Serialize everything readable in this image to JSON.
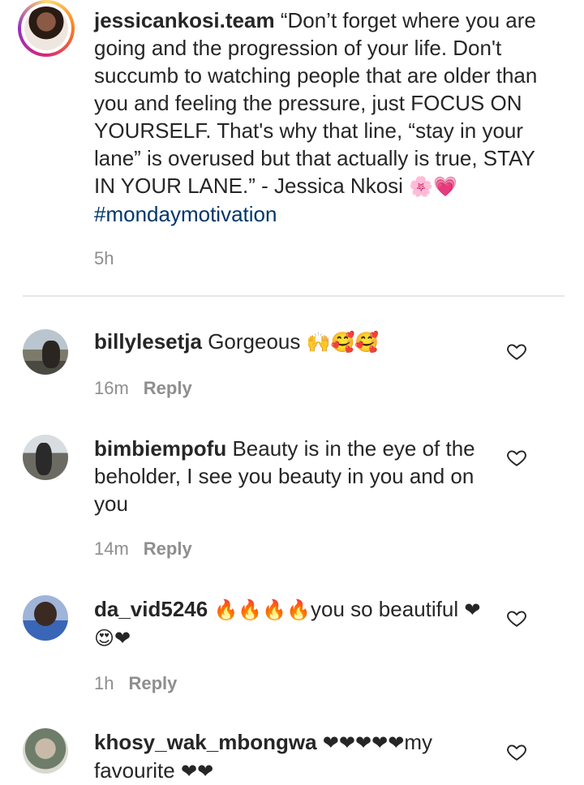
{
  "post": {
    "username": "jessicankosi.team",
    "caption": "“Don’t forget where you are going and the progression of your life. Don't succumb to watching people that are older than you and feeling the pressure, just FOCUS ON YOURSELF. That's why that line, “stay in your lane” is overused but that actually is true, STAY IN YOUR LANE.” - Jessica Nkosi",
    "emojis": "🌸💗",
    "hashtag": "#mondaymotivation",
    "time": "5h"
  },
  "reply_label": "Reply",
  "comments": [
    {
      "username": "billylesetja",
      "text": "Gorgeous",
      "emojis": "🙌🥰🥰",
      "time": "16m"
    },
    {
      "username": "bimbiempofu",
      "text": "Beauty is in the eye of the beholder, I see you beauty in you and on you",
      "emojis": "",
      "time": "14m"
    },
    {
      "username": "da_vid5246",
      "pre_emojis": "🔥🔥🔥🔥",
      "text": "you so beautiful",
      "emojis": "❤😍❤",
      "time": "1h"
    },
    {
      "username": "khosy_wak_mbongwa",
      "pre_emojis": "❤❤❤❤❤",
      "text": "my favourite",
      "emojis": "❤❤"
    }
  ],
  "colors": {
    "hashtag": "#00376b",
    "meta": "#8e8e8e",
    "ring": "#e1306c"
  },
  "icons": {
    "like": "heart-outline-icon"
  }
}
